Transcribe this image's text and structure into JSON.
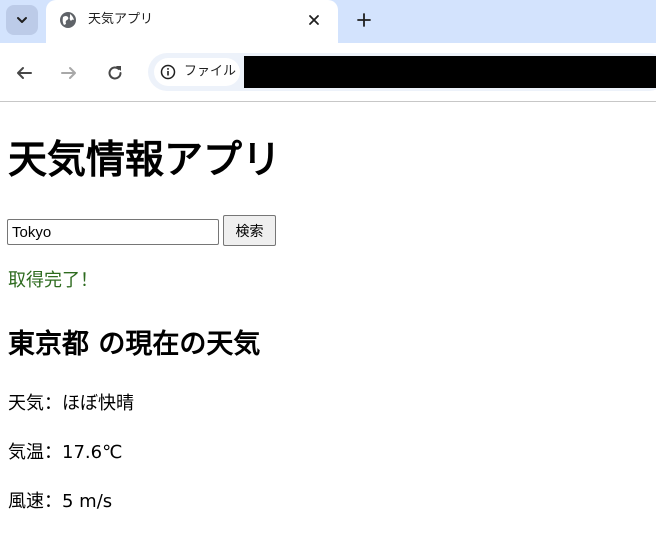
{
  "browser": {
    "tab_title": "天気アプリ",
    "site_chip_label": "ファイル",
    "icons": {
      "tab_search": "chevron-down-icon",
      "favicon": "globe-icon",
      "close": "close-icon",
      "new_tab": "plus-icon",
      "back": "back-arrow-icon",
      "forward": "forward-arrow-icon",
      "reload": "reload-icon",
      "site_info": "info-icon"
    }
  },
  "page": {
    "title": "天気情報アプリ",
    "search": {
      "value": "Tokyo",
      "button_label": "検索"
    },
    "status": "取得完了！",
    "status_color": "#2e6b1f",
    "weather": {
      "heading": "東京都 の現在の天気",
      "condition": "天気：ほぼ快晴",
      "temperature": "気温：17.6℃",
      "wind": "風速：5 m/s"
    }
  }
}
